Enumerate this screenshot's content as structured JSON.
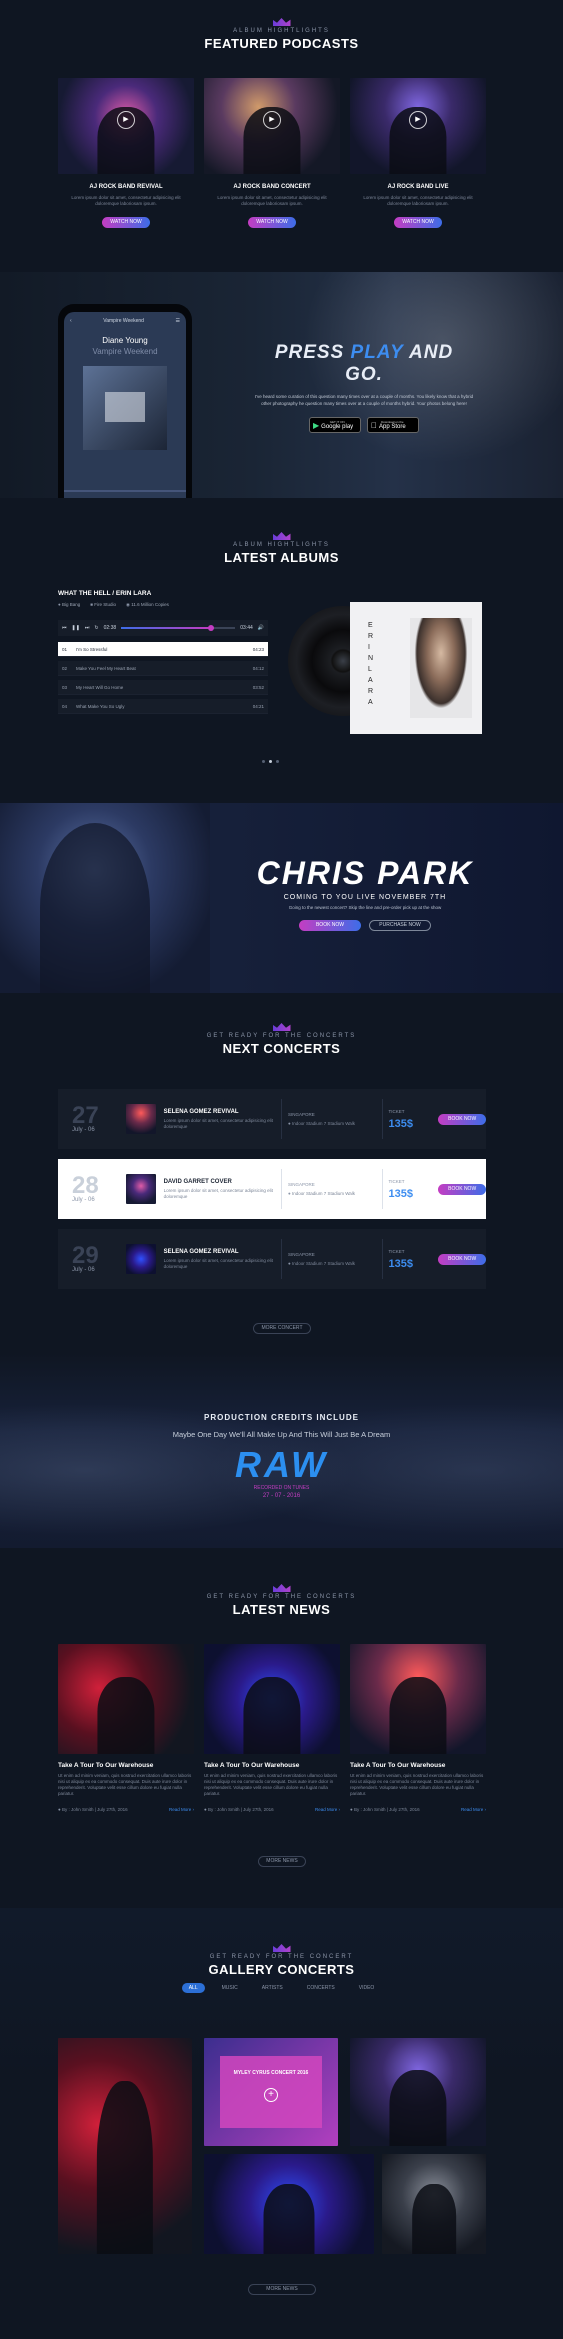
{
  "featured": {
    "eyebrow": "ALBUM HIGHTLIGHTS",
    "title": "FEATURED PODCASTS",
    "cards": [
      {
        "title": "AJ ROCK BAND REVIVAL",
        "desc": "Lorem ipsum dolor sit amet, consectetur adipisicing elit doloremque laboriosam ipsum.",
        "button": "WATCH NOW"
      },
      {
        "title": "AJ ROCK BAND  CONCERT",
        "desc": "Lorem ipsum dolor sit amet, consectetur adipisicing elit doloremque laboriosam ipsum.",
        "button": "WATCH NOW"
      },
      {
        "title": "AJ ROCK BAND LIVE",
        "desc": "Lorem ipsum dolor sit amet, consectetur adipisicing elit doloremque laboriosam ipsum.",
        "button": "WATCH NOW"
      }
    ]
  },
  "app": {
    "phone_header": "Vampire Weekend",
    "phone_song": "Diane Young",
    "phone_artist": "Vampire Weekend",
    "title_a": "PRESS ",
    "title_b": "PLAY",
    "title_c": " AND GO.",
    "desc": "I've heard some curation of this question many times over at a couple of months. You likely know that a hybrid other photography he question many times over at a couple of months hybrid. Your photos belong here!",
    "google": "Google play",
    "apple": "App Store",
    "google_small": "GET IT ON",
    "apple_small": "Download on the"
  },
  "albums": {
    "eyebrow": "ALBUM HIGHTLIGHTS",
    "title": "LATEST ALBUMS",
    "album_title": "WHAT THE HELL / ERIN LARA",
    "meta": [
      "Big Bang",
      "Fire Studio",
      "11.6 Million Copies"
    ],
    "time_start": "02:38",
    "time_end": "03:44",
    "tracks": [
      {
        "no": "01",
        "name": "I'm So Stressful",
        "time": "04:23"
      },
      {
        "no": "02",
        "name": "Make You Feel My Heart Beat",
        "time": "04:12"
      },
      {
        "no": "03",
        "name": "My Heart Will Go Home",
        "time": "03:52"
      },
      {
        "no": "04",
        "name": "What Make You So Ugly",
        "time": "04:21"
      }
    ],
    "cover_name": "ERIN LARA"
  },
  "hero": {
    "title": "CHRIS PARK",
    "subtitle": "COMING TO YOU LIVE NOVEMBER 7TH",
    "desc": "Going to the newest concert? Skip the line and pre-order pick up at the show",
    "book": "BOOK NOW",
    "purchase": "PURCHASE NOW"
  },
  "concerts": {
    "eyebrow": "GET READY FOR THE CONCERTS",
    "title": "NEXT CONCERTS",
    "items": [
      {
        "day": "27",
        "month": "July - 06",
        "name": "SELENA GOMEZ REVIVAL",
        "desc": "Lorem ipsum dolor sit amet, consectetur adipisicing elit doloremque",
        "city": "SINGAPORE",
        "venue": "Indoor Stadium 7 Stadium Walk",
        "ticket": "TICKET",
        "price": "135$",
        "button": "BOOK NOW"
      },
      {
        "day": "28",
        "month": "July - 06",
        "name": "DAVID GARRET COVER",
        "desc": "Lorem ipsum dolor sit amet, consectetur adipisicing elit doloremque",
        "city": "SINGAPORE",
        "venue": "Indoor Stadium 7 Stadium Walk",
        "ticket": "TICKET",
        "price": "135$",
        "button": "BOOK NOW"
      },
      {
        "day": "29",
        "month": "July - 06",
        "name": "SELENA GOMEZ REVIVAL",
        "desc": "Lorem ipsum dolor sit amet, consectetur adipisicing elit doloremque",
        "city": "SINGAPORE",
        "venue": "Indoor Stadium 7 Stadium Walk",
        "ticket": "TICKET",
        "price": "135$",
        "button": "BOOK NOW"
      }
    ],
    "more": "MORE CONCERT"
  },
  "credits": {
    "title": "PRODUCTION CREDITS INCLUDE",
    "subtitle": "Maybe One Day We'll All Make Up And This Will Just Be A Dream",
    "brand": "RAW",
    "label": "RECORDED ON TUNES",
    "date": "27 - 07 - 2016"
  },
  "news": {
    "eyebrow": "GET READY FOR THE CONCERTS",
    "title": "LATEST NEWS",
    "items": [
      {
        "title": "Take A Tour To Our Warehouse",
        "desc": "Ut enim ad minim veniam, quis nostrud exercitation ullamco laboris nisi ut aliquip ex ea commodo consequat. Duis aute irure dolor in reprehenderit. Voluptate velit esse cillum dolore eu fugiat nulla pariatur.",
        "author": "By : John Smith",
        "date": "July 27th, 2016",
        "more": "Read More"
      },
      {
        "title": "Take A Tour To Our Warehouse",
        "desc": "Ut enim ad minim veniam, quis nostrud exercitation ullamco laboris nisi ut aliquip ex ea commodo consequat. Duis aute irure dolor in reprehenderit. Voluptate velit esse cillum dolore eu fugiat nulla pariatur.",
        "author": "By : John Smith",
        "date": "July 27th, 2016",
        "more": "Read More"
      },
      {
        "title": "Take A Tour To Our Warehouse",
        "desc": "Ut enim ad minim veniam, quis nostrud exercitation ullamco laboris nisi ut aliquip ex ea commodo consequat. Duis aute irure dolor in reprehenderit. Voluptate velit esse cillum dolore eu fugiat nulla pariatur.",
        "author": "By : John Smith",
        "date": "July 27th, 2016",
        "more": "Read More"
      }
    ],
    "more": "MORE NEWS"
  },
  "gallery": {
    "eyebrow": "GET READY FOR THE CONCERT",
    "title": "GALLERY CONCERTS",
    "tabs": [
      "ALL",
      "MUSIC",
      "ARTISTS",
      "CONCERTS",
      "VIDEO"
    ],
    "overlay_title": "MYLEY CYRUS CONCERT 2016",
    "more": "MORE NEWS"
  },
  "colors": {
    "accent_pink": "#c43dc2",
    "accent_blue": "#3d6de8",
    "price_blue": "#3d8df0",
    "background": "#0e1520"
  }
}
